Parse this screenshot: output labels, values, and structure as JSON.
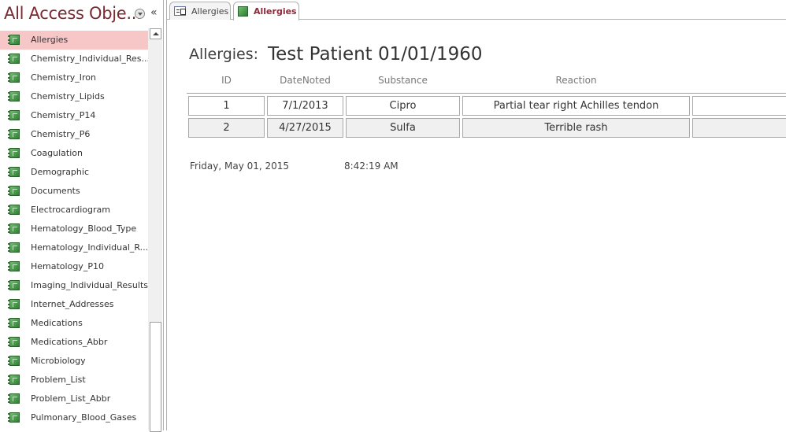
{
  "nav_pane": {
    "title": "All Access Obje...",
    "dropdown_icon": "chevron-down-circle-icon",
    "collapse_label": "«",
    "items": [
      {
        "label": "Allergies",
        "selected": true
      },
      {
        "label": "Chemistry_Individual_Res..."
      },
      {
        "label": "Chemistry_Iron"
      },
      {
        "label": "Chemistry_Lipids"
      },
      {
        "label": "Chemistry_P14"
      },
      {
        "label": "Chemistry_P6"
      },
      {
        "label": "Coagulation"
      },
      {
        "label": "Demographic"
      },
      {
        "label": "Documents"
      },
      {
        "label": "Electrocardiogram"
      },
      {
        "label": "Hematology_Blood_Type"
      },
      {
        "label": "Hematology_Individual_R..."
      },
      {
        "label": "Hematology_P10"
      },
      {
        "label": "Imaging_Individual_Results"
      },
      {
        "label": "Internet_Addresses"
      },
      {
        "label": "Medications"
      },
      {
        "label": "Medications_Abbr"
      },
      {
        "label": "Microbiology"
      },
      {
        "label": "Problem_List"
      },
      {
        "label": "Problem_List_Abbr"
      },
      {
        "label": "Pulmonary_Blood_Gases"
      }
    ]
  },
  "tabs": [
    {
      "label": "Allergies",
      "icon": "form-icon",
      "active": false
    },
    {
      "label": "Allergies",
      "icon": "report-icon",
      "active": true
    }
  ],
  "report": {
    "caption": "Allergies:",
    "title": "Test Patient 01/01/1960",
    "columns": [
      "ID",
      "DateNoted",
      "Substance",
      "Reaction"
    ],
    "rows": [
      {
        "id": "1",
        "date_noted": "7/1/2013",
        "substance": "Cipro",
        "reaction": "Partial tear right Achilles tendon",
        "extra": ""
      },
      {
        "id": "2",
        "date_noted": "4/27/2015",
        "substance": "Sulfa",
        "reaction": "Terrible rash",
        "extra": ""
      }
    ],
    "footer_date": "Friday, May 01, 2015",
    "footer_time": "8:42:19 AM"
  },
  "colors": {
    "title_accent": "#7a2a32",
    "selected_item_bg": "#f7c7c8",
    "active_tab_text": "#8a2a3a"
  }
}
